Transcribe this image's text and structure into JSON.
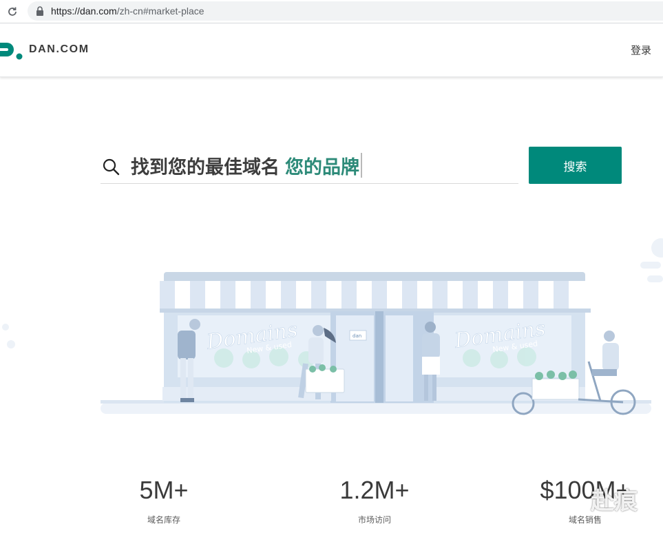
{
  "browser": {
    "url_host": "https://dan.com",
    "url_path": "/zh-cn#market-place"
  },
  "header": {
    "logo_text": "DAN.COM",
    "login_label": "登录"
  },
  "search": {
    "static_text": "找到您的最佳域名",
    "typed_text": "您的品牌",
    "button_label": "搜索"
  },
  "illustration": {
    "sign_left": "Domains",
    "sign_left_sub": "New & used",
    "sign_right": "Domains",
    "sign_right_sub": "New & used",
    "door_tag": "dan"
  },
  "stats": [
    {
      "value": "5M+",
      "label": "域名库存"
    },
    {
      "value": "1.2M+",
      "label": "市场访问"
    },
    {
      "value": "$100M+",
      "label": "域名销售"
    }
  ],
  "watermark": "赴痕",
  "colors": {
    "brand": "#00897b",
    "typed": "#2c8a78",
    "awning_stripe": "#dde7f3",
    "storefront": "#c6d7ea"
  }
}
